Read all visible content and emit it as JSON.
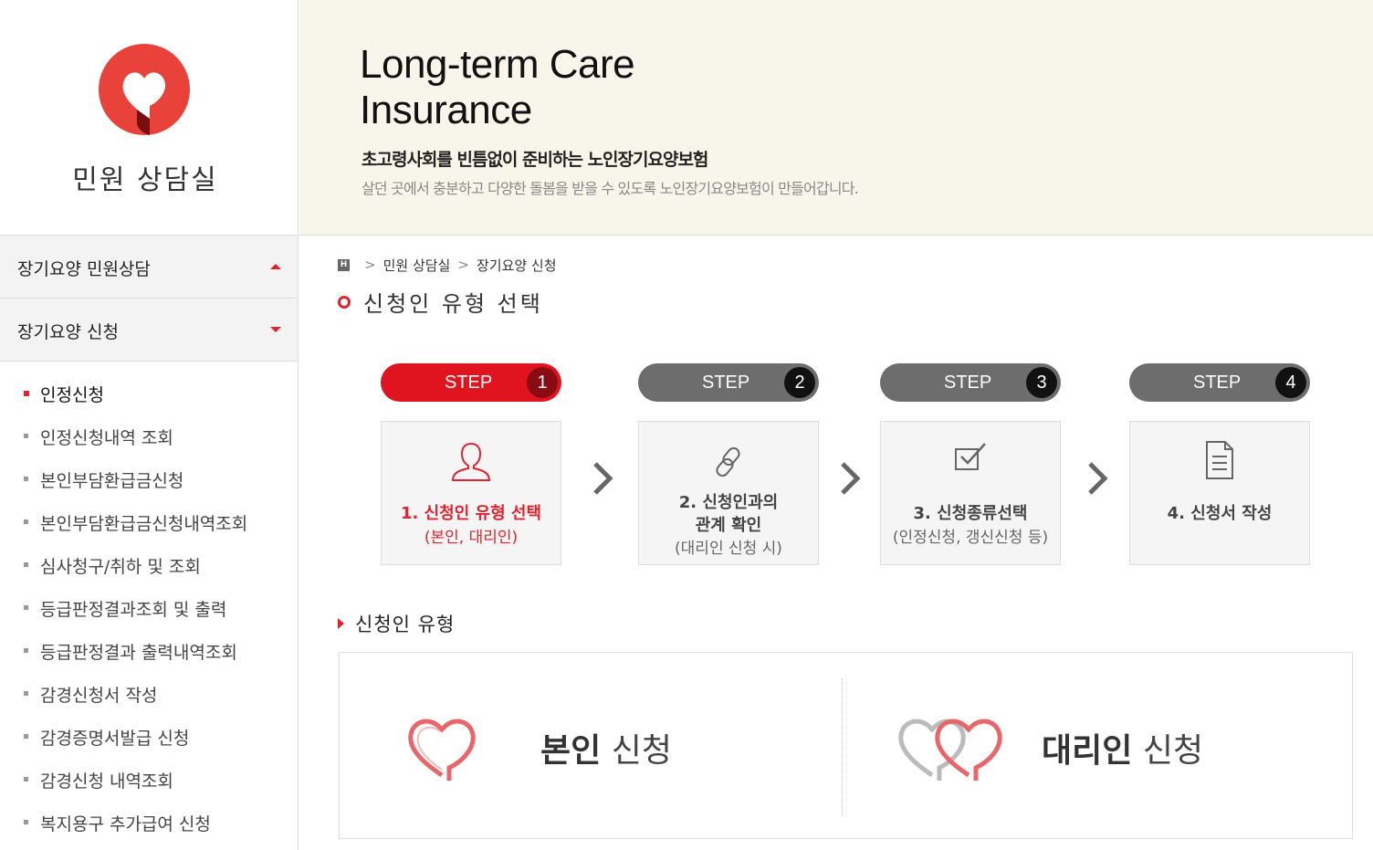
{
  "sidebar": {
    "title": "민원 상담실",
    "accordion": [
      {
        "label": "장기요양 민원상담",
        "state": "expanded-up"
      },
      {
        "label": "장기요양 신청",
        "state": "collapsed-down"
      }
    ],
    "submenu": [
      {
        "label": "인정신청",
        "active": true
      },
      {
        "label": "인정신청내역 조회"
      },
      {
        "label": "본인부담환급금신청"
      },
      {
        "label": "본인부담환급금신청내역조회"
      },
      {
        "label": "심사청구/취하 및 조회"
      },
      {
        "label": "등급판정결과조회 및 출력"
      },
      {
        "label": "등급판정결과 출력내역조회"
      },
      {
        "label": "감경신청서 작성"
      },
      {
        "label": "감경증명서발급 신청"
      },
      {
        "label": "감경신청 내역조회"
      },
      {
        "label": "복지용구 추가급여 신청"
      }
    ]
  },
  "banner": {
    "title": "Long-term Care Insurance",
    "subtitle": "초고령사회를 빈틈없이 준비하는 노인장기요양보험",
    "desc": "살던 곳에서 충분하고 다양한 돌봄을 받을 수 있도록 노인장기요양보험이 만들어갑니다."
  },
  "breadcrumb": {
    "home_icon": "home-icon",
    "items": [
      "민원 상담실",
      "장기요양 신청"
    ]
  },
  "page_title": "신청인 유형 선택",
  "steps": [
    {
      "label": "STEP",
      "num": "1",
      "line1": "1. 신청인 유형 선택",
      "line2": "(본인, 대리인)",
      "icon": "person-icon",
      "active": true
    },
    {
      "label": "STEP",
      "num": "2",
      "line1": "2. 신청인과의",
      "line1b": "관계 확인",
      "line2": "(대리인 신청 시)",
      "icon": "link-icon"
    },
    {
      "label": "STEP",
      "num": "3",
      "line1": "3. 신청종류선택",
      "line2": "(인정신청, 갱신신청 등)",
      "icon": "checkbox-icon"
    },
    {
      "label": "STEP",
      "num": "4",
      "line1": "4. 신청서 작성",
      "icon": "document-icon"
    }
  ],
  "section": {
    "title": "신청인 유형",
    "choices": [
      {
        "bold": "본인",
        "rest": " 신청",
        "icon": "heart-icon"
      },
      {
        "bold": "대리인",
        "rest": " 신청",
        "icon": "double-heart-icon"
      }
    ]
  },
  "colors": {
    "accent": "#e0242f",
    "banner_bg": "#f8f6ea",
    "step_inactive": "#6d6d6d"
  }
}
